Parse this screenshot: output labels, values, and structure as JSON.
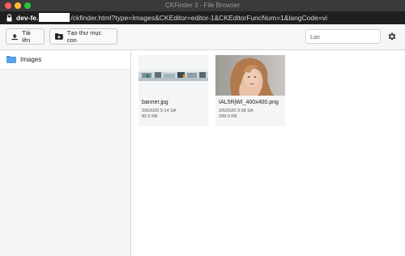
{
  "window": {
    "title": "CKFinder 3 - File Browser"
  },
  "url": {
    "host": "dev-fe.",
    "path": "/ckfinder.html?type=Images&CKEditor=editor-1&CKEditorFuncNum=1&langCode=vi"
  },
  "toolbar": {
    "upload_label": "Tải lên",
    "new_folder_label": "Tạo thư mục con",
    "filter_placeholder": "Lọc"
  },
  "sidebar": {
    "folders": [
      {
        "label": "Images"
      }
    ]
  },
  "files": [
    {
      "name": "banner.jpg",
      "date": "3/6/2020 5:14 SA",
      "size": "82.0 KB"
    },
    {
      "name": "IAL5RjWI_400x400.png",
      "date": "3/6/2020 9:38 SA",
      "size": "299.0 KB"
    }
  ],
  "colors": {
    "folder_icon": "#4a90d9",
    "titlebar": "#3a3a3a"
  }
}
